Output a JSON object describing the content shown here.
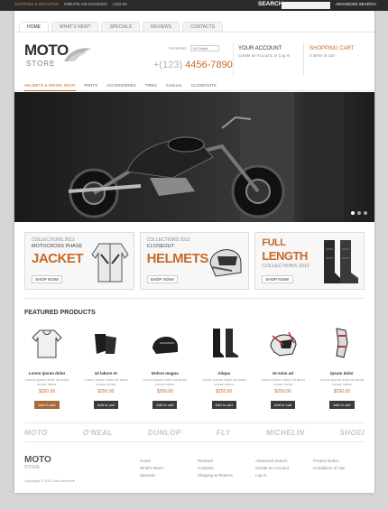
{
  "topbar": {
    "links": [
      "Shipping & Returns",
      "Create an Account",
      "Log In"
    ],
    "search_label": "SEARCH:",
    "search_placeholder": "",
    "advanced_search": "Advanced Search"
  },
  "tabs": [
    "Home",
    "What's New?",
    "Specials",
    "Reviews",
    "Contacts"
  ],
  "logo": {
    "line1": "MOTO",
    "line2": "STORE"
  },
  "currency": {
    "label": "Currencies:",
    "value": "US Dollar"
  },
  "phone": {
    "prefix": "+(123)",
    "number": "4456-7890"
  },
  "account": {
    "title": "Your Account",
    "subtitle": "Create an Account, or Log In"
  },
  "cart": {
    "title": "Shopping Cart",
    "subtitle": "0 items in cart"
  },
  "nav": [
    "Helmets & Riding Gear",
    "Parts",
    "Accessories",
    "Tires",
    "Casual",
    "Closeouts"
  ],
  "banners": [
    {
      "line1": "Collections 2012",
      "line2": "Motocross Phase",
      "line3": "Jacket",
      "button": "Shop Now!"
    },
    {
      "line1": "Collections 2012",
      "line2": "Closeout",
      "line3": "Helmets",
      "button": "Shop Now!"
    },
    {
      "line1": "Full",
      "line2": "Length",
      "line3": "Collections 2012",
      "button": "Shop Now!"
    }
  ],
  "featured_title": "Featured Products",
  "products": [
    {
      "name": "Lorem ipsum dolor",
      "desc": "Lorem ipsum dolor sit amet conse ctetur",
      "price": "$250.00",
      "button": "Add to cart"
    },
    {
      "name": "Ut labore et",
      "desc": "Lorem ipsum dolor sit amet conse ctetur",
      "price": "$250.00",
      "button": "Add to cart"
    },
    {
      "name": "Dolore magna",
      "desc": "Lorem ipsum dolor sit amet conse ctetur",
      "price": "$250.00",
      "button": "Add to cart"
    },
    {
      "name": "Aliqua",
      "desc": "Lorem ipsum dolor sit amet conse ctetur",
      "price": "$250.00",
      "button": "Add to cart"
    },
    {
      "name": "Ut enim ad",
      "desc": "Lorem ipsum dolor sit amet conse ctetur",
      "price": "$250.00",
      "button": "Add to cart"
    },
    {
      "name": "Ipsum dolor",
      "desc": "Lorem ipsum dolor sit amet conse ctetur",
      "price": "$250.00",
      "button": "Add to cart"
    }
  ],
  "brands": [
    "MOTO",
    "O'NEAL",
    "DUNLOP",
    "FLY",
    "MICHELIN",
    "SHOEI"
  ],
  "footer": {
    "logo_line1": "MOTO",
    "logo_line2": "STORE",
    "copyright": "Copyright © 2012 osCommerce",
    "col1": [
      "Home",
      "What's New?",
      "Specials"
    ],
    "col2": [
      "Reviews",
      "Contacts",
      "Shipping & Returns"
    ],
    "col3": [
      "Advanced Search",
      "Create an Account",
      "Log In"
    ],
    "col4": [
      "Privacy Notice",
      "Conditions of Use"
    ]
  },
  "colors": {
    "accent": "#c56a2a",
    "dark": "#2b2b2b"
  }
}
